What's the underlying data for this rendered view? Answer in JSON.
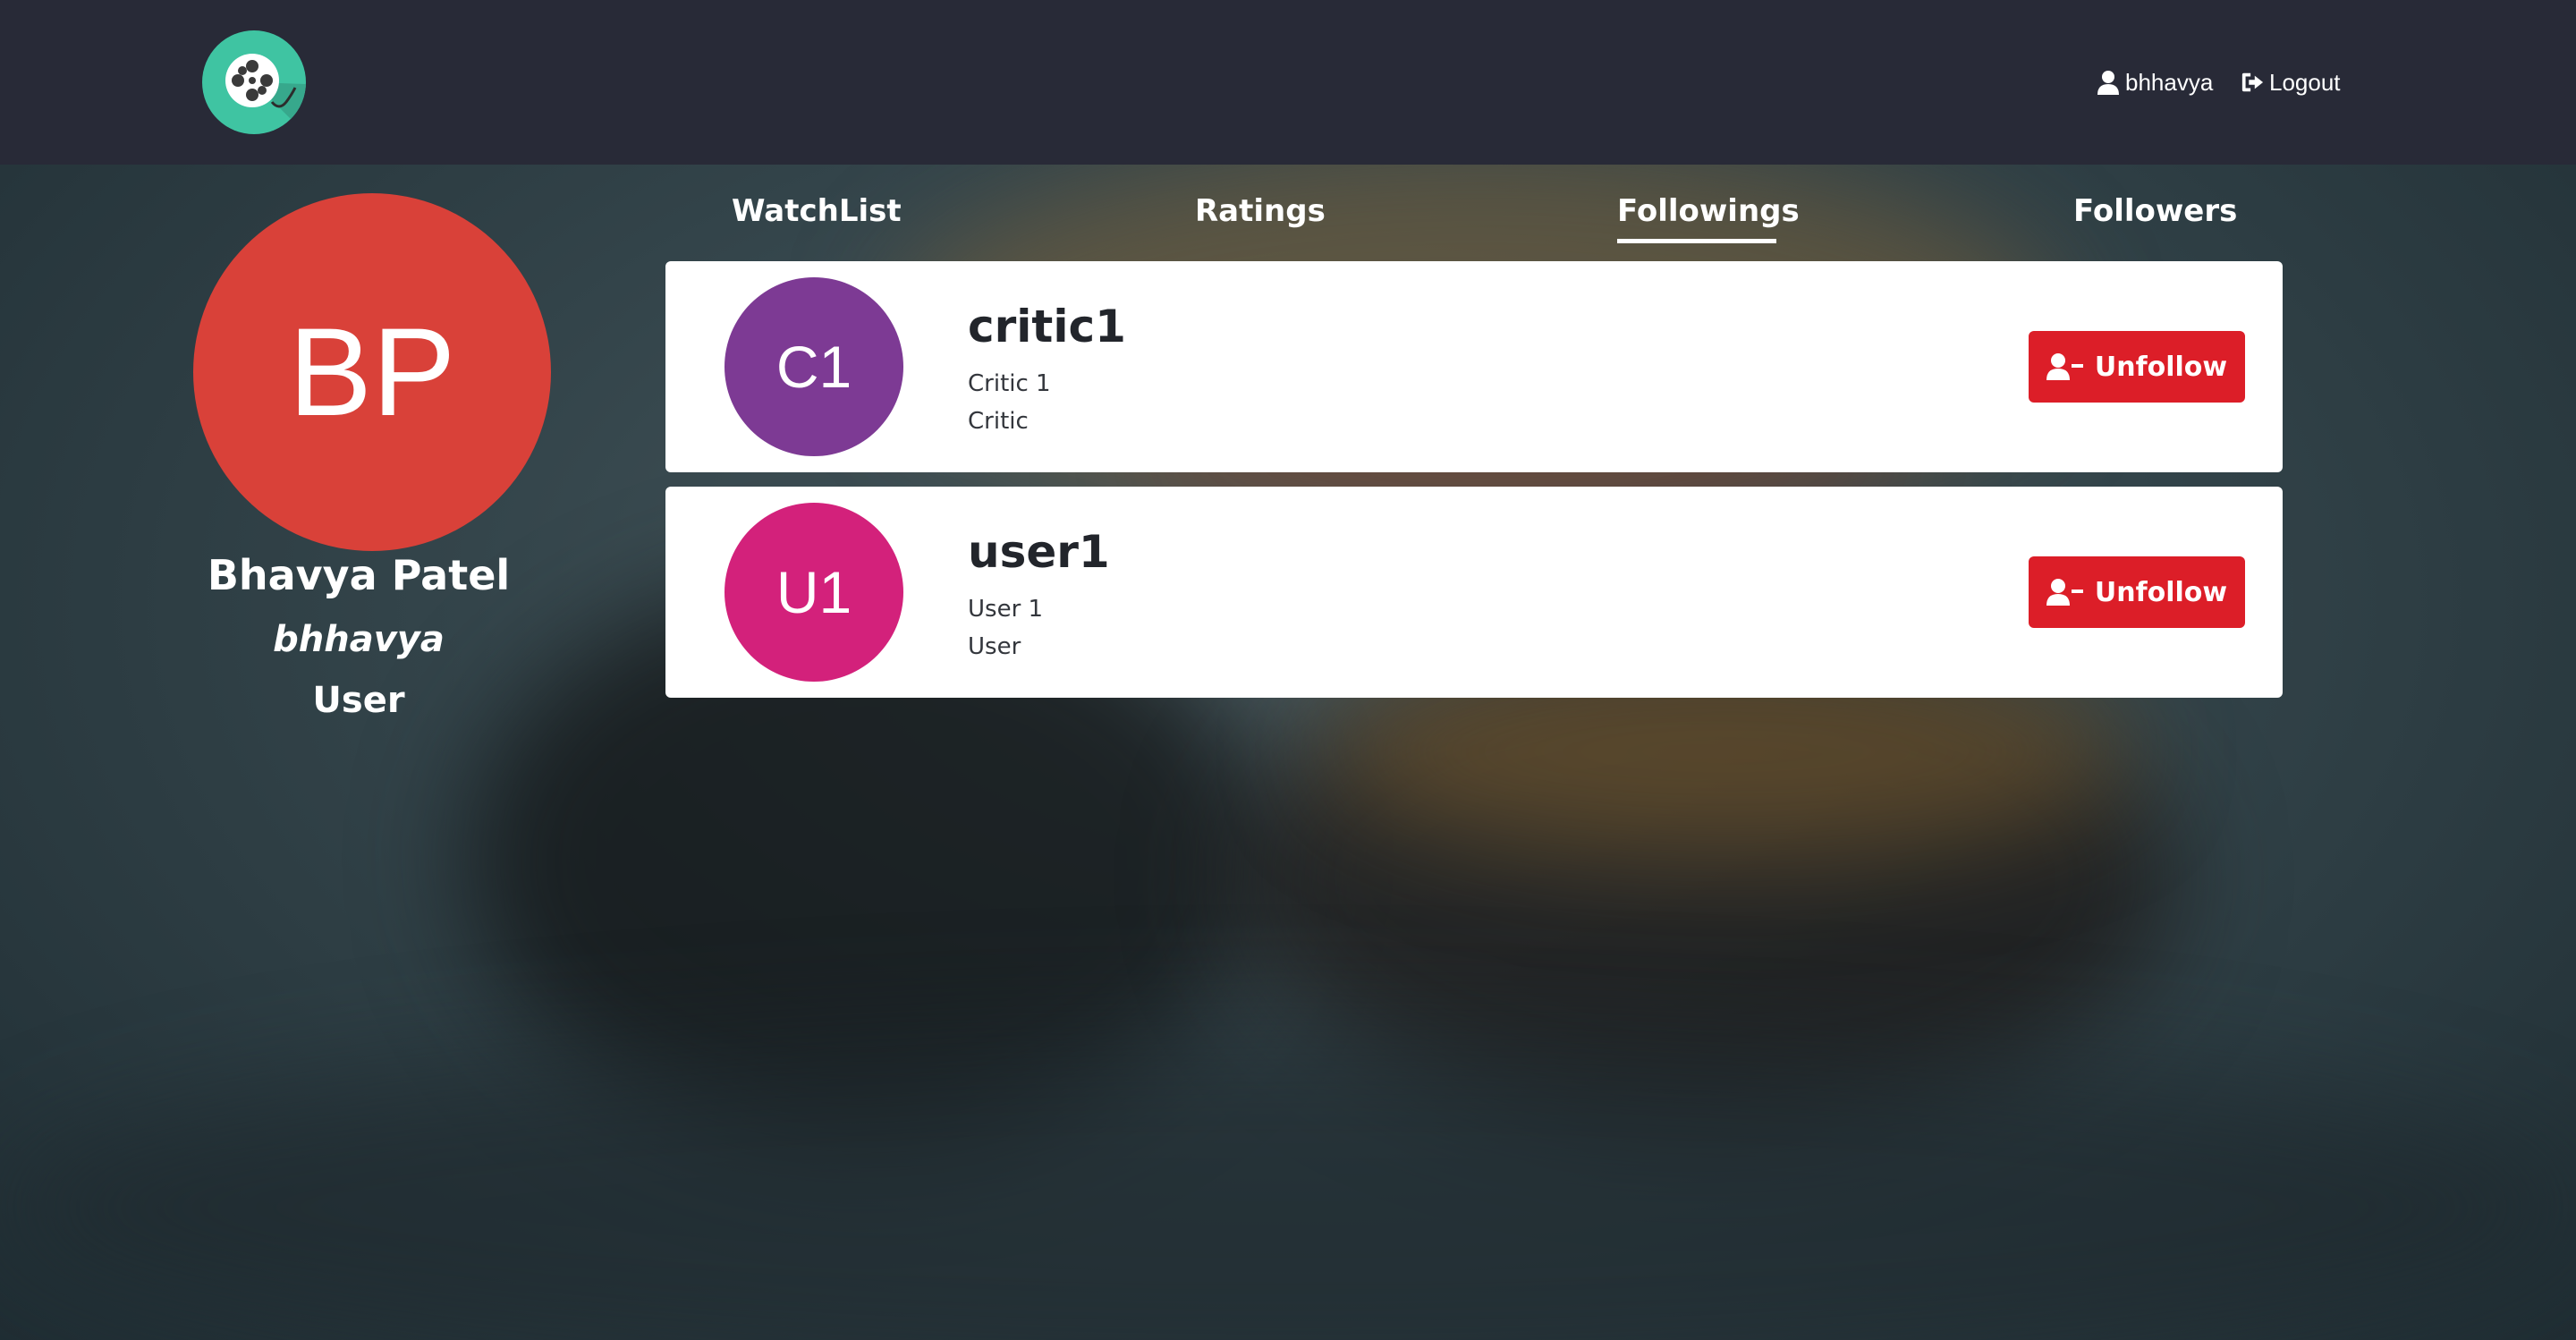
{
  "nav": {
    "logo_icon": "film-reel-icon",
    "username": "bhhavya",
    "logout_label": "Logout"
  },
  "profile": {
    "initials": "BP",
    "avatar_color": "#d94139",
    "name": "Bhavya Patel",
    "handle": "bhhavya",
    "role": "User"
  },
  "tabs": [
    {
      "label": "WatchList",
      "active": false
    },
    {
      "label": "Ratings",
      "active": false
    },
    {
      "label": "Followings",
      "active": true
    },
    {
      "label": "Followers",
      "active": false
    }
  ],
  "followings": [
    {
      "initials": "C1",
      "avatar_color": "#7d3a94",
      "username": "critic1",
      "full_name": "Critic 1",
      "role": "Critic",
      "action_label": "Unfollow"
    },
    {
      "initials": "U1",
      "avatar_color": "#d3217b",
      "username": "user1",
      "full_name": "User 1",
      "role": "User",
      "action_label": "Unfollow"
    }
  ],
  "colors": {
    "navbar": "#282a37",
    "logo": "#3fc4a2",
    "unfollow_button": "#dc1e28"
  }
}
